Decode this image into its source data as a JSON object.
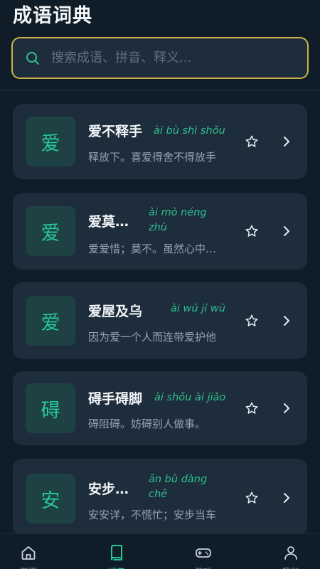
{
  "header": {
    "title": "成语词典",
    "search_placeholder": "搜索成语、拼音、释义..."
  },
  "idioms": [
    {
      "badge": "爱",
      "name": "爱不释手",
      "pinyin": "ài bù shì shǒu",
      "desc": "释放下。喜爱得舍不得放手"
    },
    {
      "badge": "爱",
      "name": "爱莫…",
      "pinyin": "ài mò néng zhù",
      "desc": "爱爱惜；莫不。虽然心中关切"
    },
    {
      "badge": "爱",
      "name": "爱屋及乌",
      "pinyin": "ài wū jí wū",
      "desc": "因为爱一个人而连带爱护他"
    },
    {
      "badge": "碍",
      "name": "碍手碍脚",
      "pinyin": "ài shǒu ài jiǎo",
      "desc": "碍阻碍。妨碍别人做事。"
    },
    {
      "badge": "安",
      "name": "安步…",
      "pinyin": "ān bù dàng chē",
      "desc": "安安详，不慌忙；安步当车"
    }
  ],
  "tabs": [
    {
      "label": "首页"
    },
    {
      "label": "词典"
    },
    {
      "label": "游戏"
    },
    {
      "label": "我的"
    }
  ],
  "colors": {
    "accent": "#27c79a",
    "search_border": "#cdb14a",
    "card_bg": "#1e2d3b",
    "page_bg": "#0f1d28"
  }
}
